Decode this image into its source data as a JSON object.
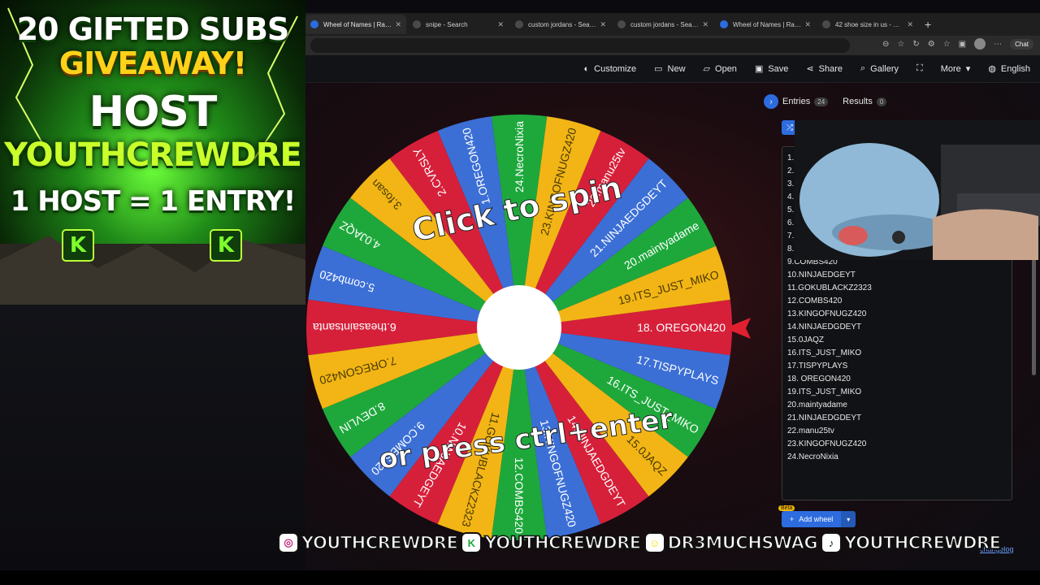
{
  "browser": {
    "tabs": [
      {
        "title": "Wheel of Names | Rand",
        "active": true,
        "fav": "#2d6cdf"
      },
      {
        "title": "snipe - Search",
        "active": false,
        "fav": "#4a4a4a"
      },
      {
        "title": "custom jordans - Search",
        "active": false,
        "fav": "#4a4a4a"
      },
      {
        "title": "custom jordans - Search",
        "active": false,
        "fav": "#4a4a4a"
      },
      {
        "title": "Wheel of Names | Rand",
        "active": false,
        "fav": "#2d6cdf"
      },
      {
        "title": "42 shoe size in us - Sea",
        "active": false,
        "fav": "#4a4a4a"
      }
    ],
    "chat_label": "Chat"
  },
  "appbar": {
    "customize": "Customize",
    "new": "New",
    "open": "Open",
    "save": "Save",
    "share": "Share",
    "gallery": "Gallery",
    "more": "More",
    "language": "English"
  },
  "wheel": {
    "prompt_top": "Click to spin",
    "prompt_bottom": "or press ctrl+enter"
  },
  "panel": {
    "entries_label": "Entries",
    "entries_count": "24",
    "results_label": "Results",
    "results_count": "0",
    "add_wheel": "Add wheel",
    "beta": "Beta",
    "changelog": "changelog"
  },
  "entries": [
    "1.",
    "2.",
    "3.",
    "4.",
    "5.",
    "6.",
    "7.",
    "8.",
    "9.COMBS420",
    "10.NINJAEDGEYT",
    "11.GOKUBLACKZ2323",
    "12.COMBS420",
    "13.KINGOFNUGZ420",
    "14.NINJAEDGDEYT",
    "15.0JAQZ",
    "16.ITS_JUST_MIKO",
    "17.TISPYPLAYS",
    "18. OREGON420",
    "19.ITS_JUST_MIKO",
    "20.maintyadame",
    "21.NINJAEDGDEYT",
    "22.manu25tv",
    "23.KINGOFNUGZ420",
    "24.NecroNixia"
  ],
  "slices": [
    "18. OREGON420",
    "19.ITS_JUST_MIKO",
    "20.maintyadame",
    "21.NINJAEDGDEYT",
    "22.manu25tv",
    "23.KINGOFNUGZ420",
    "24.NecroNixia",
    "1.OREGON420",
    "2.CVRSLY",
    "3.fosan",
    "4.0JAQZ",
    "5.comb420",
    "6.theasaintsanta",
    "7.OREGON420",
    "8.DEVLIN",
    "9.COMBS420",
    "10.NINJAEDGEYT",
    "11.GOKUBLACKZ2323",
    "12.COMBS420",
    "13.KINGOFNUGZ420",
    "14.NINJAEDGDEYT",
    "15.0JAQZ",
    "16.ITS_JUST_MIKO",
    "17.TISPYPLAYS"
  ],
  "slice_colors": [
    "#d6203a",
    "#f2b515",
    "#1ea83c",
    "#3b6fd6"
  ],
  "overlay": {
    "line1": "20 GIFTED SUBS",
    "line2": "GIVEAWAY!",
    "line3": "HOST",
    "line4": "YOUTHCREWDRE",
    "line5": "1 HOST = 1 ENTRY!",
    "k_logo": "K"
  },
  "social": [
    {
      "icon": "instagram-icon",
      "glyph": "◎",
      "color": "#c2307a",
      "handle": "YOUTHCREWDRE"
    },
    {
      "icon": "kick-icon",
      "glyph": "K",
      "color": "#1ea83c",
      "handle": "YOUTHCREWDRE"
    },
    {
      "icon": "snapchat-icon",
      "glyph": "☺",
      "color": "#f5e100",
      "handle": "DR3MUCHSWAG"
    },
    {
      "icon": "tiktok-icon",
      "glyph": "♪",
      "color": "#111111",
      "handle": "YOUTHCREWDRE"
    }
  ]
}
